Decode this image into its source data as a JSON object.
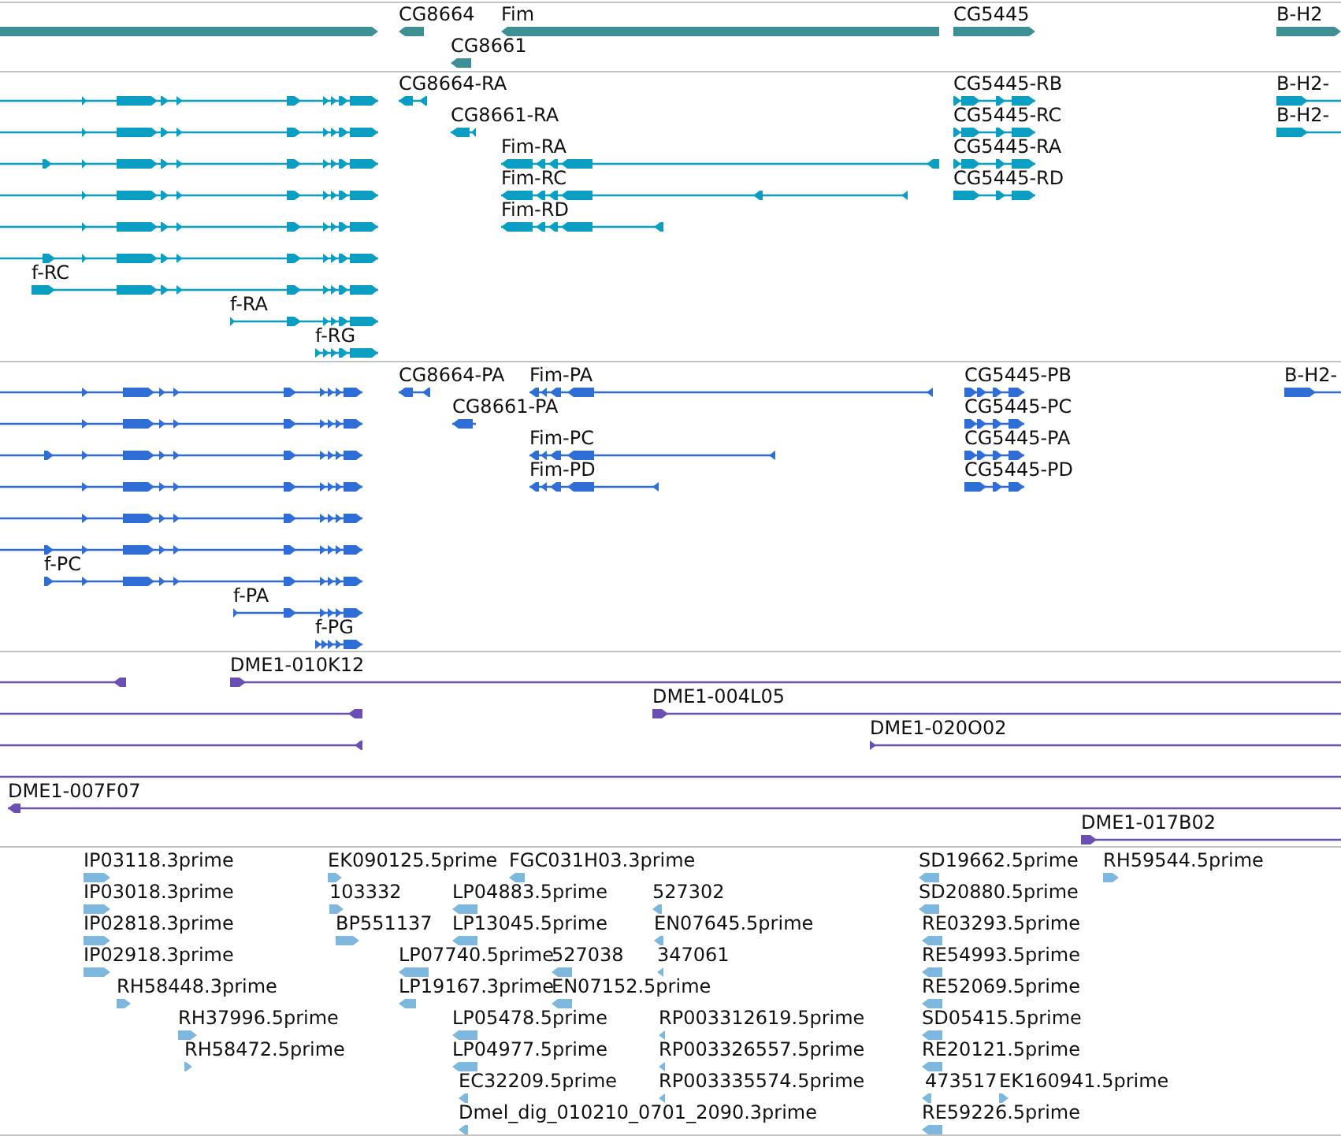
{
  "tracks": [
    {
      "kind": "genes",
      "color": "#3f9095",
      "features": [
        {
          "forward": true
        },
        {
          "label": "CG8664",
          "forward": false
        },
        {
          "label": "Fim",
          "forward": false
        },
        {
          "label": "CG8661",
          "forward": false
        },
        {
          "label": "CG5445",
          "forward": true
        },
        {
          "label": "B-H2",
          "forward": true
        }
      ]
    },
    {
      "kind": "transcripts",
      "color": "#0a9fc2",
      "features": [
        {
          "forward": true
        },
        {
          "forward": true
        },
        {
          "forward": true
        },
        {
          "forward": true
        },
        {
          "forward": true
        },
        {
          "forward": true
        },
        {
          "label": "f-RC",
          "forward": true
        },
        {
          "label": "f-RA",
          "forward": true
        },
        {
          "label": "f-RG",
          "forward": true
        },
        {
          "label": "CG8664-RA",
          "forward": false
        },
        {
          "label": "CG8661-RA",
          "forward": false
        },
        {
          "label": "Fim-RA",
          "forward": false
        },
        {
          "label": "Fim-RC",
          "forward": false
        },
        {
          "label": "Fim-RD",
          "forward": false
        },
        {
          "label": "CG5445-RB",
          "forward": true
        },
        {
          "label": "CG5445-RC",
          "forward": true
        },
        {
          "label": "CG5445-RA",
          "forward": true
        },
        {
          "label": "CG5445-RD",
          "forward": true
        },
        {
          "label": "B-H2-",
          "forward": true
        },
        {
          "label": "B-H2-",
          "forward": true
        }
      ]
    },
    {
      "kind": "transcripts",
      "color": "#2e6ed6",
      "features": [
        {
          "forward": true
        },
        {
          "forward": true
        },
        {
          "forward": true
        },
        {
          "forward": true
        },
        {
          "forward": true
        },
        {
          "forward": true
        },
        {
          "label": "f-PC",
          "forward": true
        },
        {
          "label": "f-PA",
          "forward": true
        },
        {
          "label": "f-PG",
          "forward": true
        },
        {
          "label": "CG8664-PA",
          "forward": false
        },
        {
          "label": "CG8661-PA",
          "forward": false
        },
        {
          "label": "Fim-PA",
          "forward": false
        },
        {
          "label": "Fim-PC",
          "forward": false
        },
        {
          "label": "Fim-PD",
          "forward": false
        },
        {
          "label": "CG5445-PB",
          "forward": true
        },
        {
          "label": "CG5445-PC",
          "forward": true
        },
        {
          "label": "CG5445-PA",
          "forward": true
        },
        {
          "label": "CG5445-PD",
          "forward": true
        },
        {
          "label": "B-H2-",
          "forward": true
        }
      ]
    },
    {
      "kind": "clones",
      "color": "#6c4fb2",
      "features": [
        {
          "kind": "clone",
          "forward": false
        },
        {
          "kind": "clone",
          "label": "DME1-010K12",
          "forward": true
        },
        {
          "kind": "clone",
          "forward": false
        },
        {
          "kind": "clone",
          "label": "DME1-004L05",
          "forward": true
        },
        {
          "kind": "clone",
          "forward": false
        },
        {
          "kind": "clone",
          "label": "DME1-020O02",
          "forward": true
        },
        {
          "kind": "line"
        },
        {
          "kind": "clone",
          "label": "DME1-007F07",
          "forward": false
        },
        {
          "kind": "clone",
          "label": "DME1-017B02",
          "forward": true
        }
      ]
    },
    {
      "kind": "ests",
      "color": "#7fb8df",
      "features": [
        {
          "label": "IP03118.3prime",
          "forward": true
        },
        {
          "label": "EK090125.5prime",
          "forward": true
        },
        {
          "label": "FGC031H03.3prime",
          "forward": false
        },
        {
          "label": "SD19662.5prime",
          "forward": false
        },
        {
          "label": "RH59544.5prime",
          "forward": true
        },
        {
          "label": "IP03018.3prime",
          "forward": true
        },
        {
          "label": "103332",
          "forward": true
        },
        {
          "label": "LP04883.5prime",
          "forward": false
        },
        {
          "label": "527302",
          "forward": false
        },
        {
          "label": "SD20880.5prime",
          "forward": false
        },
        {
          "label": "IP02818.3prime",
          "forward": true
        },
        {
          "label": "BP551137",
          "forward": true
        },
        {
          "label": "LP13045.5prime",
          "forward": false
        },
        {
          "label": "EN07645.5prime",
          "forward": false
        },
        {
          "label": "RE03293.5prime",
          "forward": false
        },
        {
          "label": "IP02918.3prime",
          "forward": true
        },
        {
          "label": "LP07740.5prime",
          "forward": false
        },
        {
          "label": "527038",
          "forward": false
        },
        {
          "label": "347061",
          "forward": false
        },
        {
          "label": "RE54993.5prime",
          "forward": false
        },
        {
          "label": "RH58448.3prime",
          "forward": true
        },
        {
          "label": "LP19167.3prime",
          "forward": false
        },
        {
          "label": "EN07152.5prime",
          "forward": false
        },
        {
          "label": "RE52069.5prime",
          "forward": false
        },
        {
          "label": "RH37996.5prime",
          "forward": true
        },
        {
          "label": "LP05478.5prime",
          "forward": false
        },
        {
          "label": "RP003312619.5prime",
          "forward": false
        },
        {
          "label": "SD05415.5prime",
          "forward": false
        },
        {
          "label": "RH58472.5prime",
          "forward": true
        },
        {
          "label": "LP04977.5prime",
          "forward": false
        },
        {
          "label": "RP003326557.5prime",
          "forward": false
        },
        {
          "label": "RE20121.5prime",
          "forward": false
        },
        {
          "label": "EC32209.5prime",
          "forward": false
        },
        {
          "label": "RP003335574.5prime",
          "forward": false
        },
        {
          "label": "473517",
          "forward": false
        },
        {
          "label": "EK160941.5prime",
          "forward": true
        },
        {
          "label": "Dmel_dig_010210_0701_2090.3prime",
          "forward": false
        },
        {
          "label": "RE59226.5prime",
          "forward": false
        }
      ]
    }
  ]
}
